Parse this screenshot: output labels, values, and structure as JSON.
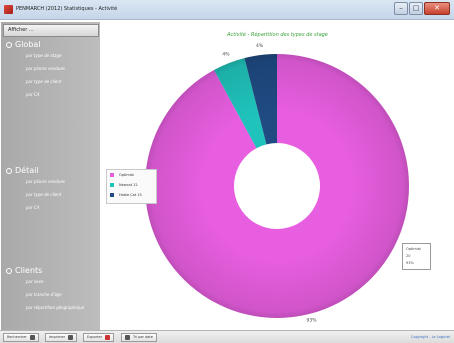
{
  "window": {
    "title": "PENMARCH (2012) Statistiques - Activité",
    "minimize_label": "–",
    "maximize_label": "□",
    "close_label": "✕"
  },
  "sidebar": {
    "show_button": "Afficher ...",
    "sections": [
      {
        "title": "Global",
        "items": [
          "par type de stage",
          "par places vendues",
          "par type de client",
          "par CA"
        ]
      },
      {
        "title": "Détail",
        "items": [
          "par places vendues",
          "par type de client",
          "par CA"
        ]
      },
      {
        "title": "Clients",
        "items": [
          "par sexe",
          "par tranche d'âge",
          "par répartition géographique"
        ]
      }
    ]
  },
  "chart_data": {
    "type": "pie",
    "title": "Activité - Répartition des types de stage",
    "categories": [
      "Optimist",
      "Newcat 12",
      "Hobie Cat 15"
    ],
    "values": [
      93,
      4,
      4
    ],
    "data_labels": [
      "93%",
      "4%",
      "4%"
    ],
    "colors": [
      "#e85ee0",
      "#1fc3bb",
      "#1f4a82"
    ],
    "donut": true,
    "legend_position": "left"
  },
  "tooltip": {
    "category": "Optimist",
    "value": "20",
    "percent": "93%"
  },
  "statusbar": {
    "buttons": [
      "Rechercher",
      "Imprimer",
      "Exporter",
      "Tri par date"
    ],
    "link": "Copyright - Le Logiciel"
  }
}
